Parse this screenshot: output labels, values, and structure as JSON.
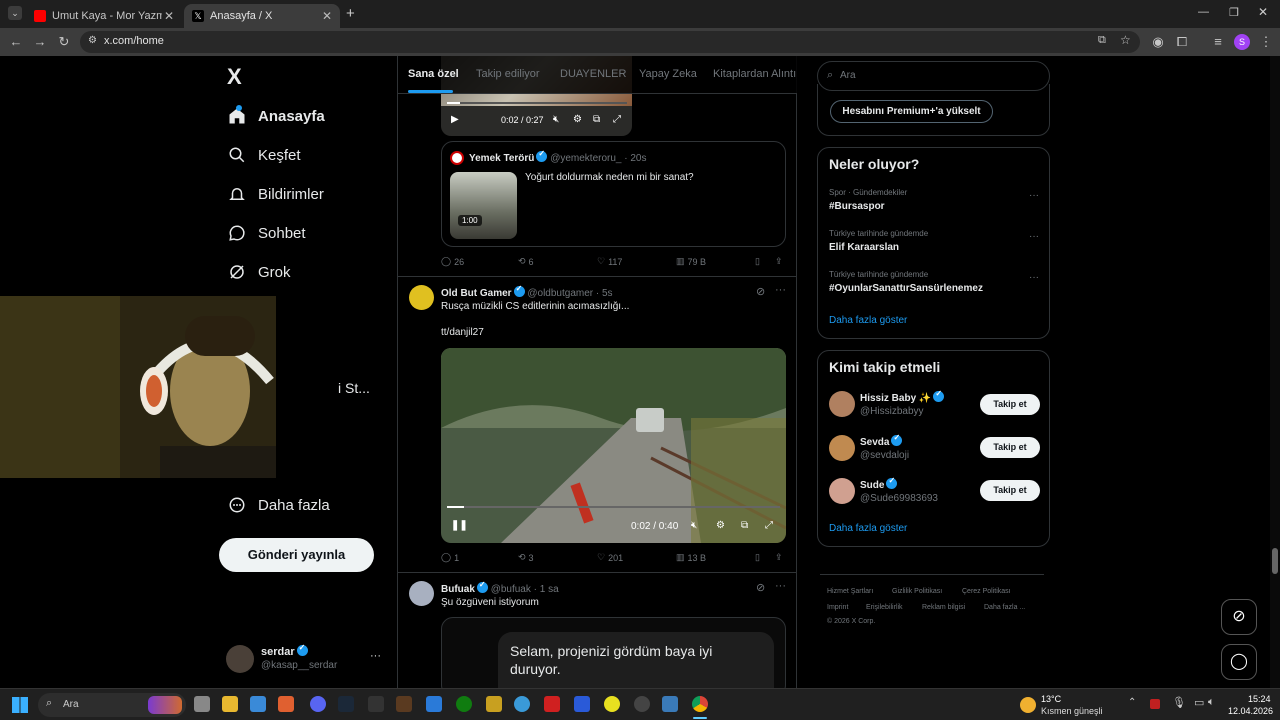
{
  "browser": {
    "tabs": [
      {
        "title": "Umut Kaya - Mor Yazma (Officia",
        "active": false
      },
      {
        "title": "Anasayfa / X",
        "active": true
      }
    ],
    "new_tab": "+",
    "url": "x.com/home"
  },
  "sidebar": {
    "logo": "X",
    "items": [
      {
        "label": "Anasayfa",
        "icon": "home-icon"
      },
      {
        "label": "Keşfet",
        "icon": "search-icon"
      },
      {
        "label": "Bildirimler",
        "icon": "bell-icon"
      },
      {
        "label": "Sohbet",
        "icon": "chat-icon"
      },
      {
        "label": "Grok",
        "icon": "grok-icon"
      },
      {
        "label": "Daha fazla",
        "icon": "more-circle-icon"
      }
    ],
    "partial_text": "i St...",
    "post_button": "Gönderi yayınla",
    "account": {
      "name": "serdar",
      "handle": "@kasap__serdar",
      "menu": "···"
    }
  },
  "feed": {
    "tabs": [
      "Sana özel",
      "Takip ediliyor",
      "DUAYENLER",
      "Yapay Zeka",
      "Kitaplardan Alıntı"
    ],
    "top_video": {
      "time": "0:02 / 0:27"
    },
    "quote": {
      "name": "Yemek Terörü",
      "handle": "@yemekteroru_",
      "age": "· 20s",
      "text": "Yoğurt doldurmak neden mi bir sanat?",
      "duration": "1:00"
    },
    "post1_actions": {
      "replies": "26",
      "reposts": "6",
      "likes": "117",
      "views": "79 B"
    },
    "post2": {
      "name": "Old But Gamer",
      "handle": "@oldbutgamer",
      "age": "· 5s",
      "text": "Rusça müzikli CS editlerinin acımasızlığı...",
      "text2": "tt/danjil27",
      "video_time": "0:02 / 0:40",
      "replies": "1",
      "reposts": "3",
      "likes": "201",
      "views": "13 B"
    },
    "post3": {
      "name": "Bufuak",
      "handle": "@bufuak",
      "age": "· 1 sa",
      "text": "Şu özgüveni istiyorum",
      "bubble": "Selam, projenizi gördüm baya iyi duruyor."
    }
  },
  "right": {
    "search_placeholder": "Ara",
    "premium_button": "Hesabını Premium+'a yükselt",
    "trends_title": "Neler oluyor?",
    "trends": [
      {
        "meta": "Spor · Gündemdekiler",
        "name": "#Bursaspor"
      },
      {
        "meta": "Türkiye tarihinde gündemde",
        "name": "Elif Karaarslan"
      },
      {
        "meta": "Türkiye tarihinde gündemde",
        "name": "#OyunlarSanattırSansürlenemez"
      }
    ],
    "show_more": "Daha fazla göster",
    "who_title": "Kimi takip etmeli",
    "who": [
      {
        "name": "Hissiz Baby ✨",
        "handle": "@Hissizbabyy",
        "button": "Takip et"
      },
      {
        "name": "Sevda",
        "handle": "@sevdaloji",
        "button": "Takip et"
      },
      {
        "name": "Sude",
        "handle": "@Sude69983693",
        "button": "Takip et"
      }
    ],
    "who_more": "Daha fazla göster",
    "footer": [
      "Hizmet Şartları",
      "Gizlilik Politikası",
      "Çerez Politikası",
      "Imprint",
      "Erişilebilirlik",
      "Reklam bilgisi",
      "Daha fazla ...",
      "© 2026 X Corp."
    ]
  },
  "taskbar": {
    "search": "Ara",
    "weather_temp": "13°C",
    "weather_text": "Kısmen güneşli",
    "time": "15:24",
    "date": "12.04.2026"
  },
  "colors": {
    "accent": "#1d9bf0",
    "bg": "#000000",
    "border": "#2f3336",
    "muted": "#71767b"
  }
}
